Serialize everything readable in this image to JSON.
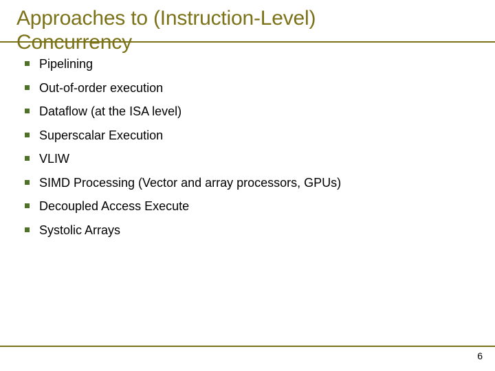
{
  "title_l1": "Approaches to (Instruction-Level)",
  "title_l2": "Concurrency",
  "items": [
    "Pipelining",
    "Out-of-order execution",
    "Dataflow (at the ISA level)",
    "Superscalar Execution",
    "VLIW",
    "SIMD Processing (Vector and array processors, GPUs)",
    "Decoupled Access Execute",
    "Systolic Arrays"
  ],
  "page_number": "6"
}
